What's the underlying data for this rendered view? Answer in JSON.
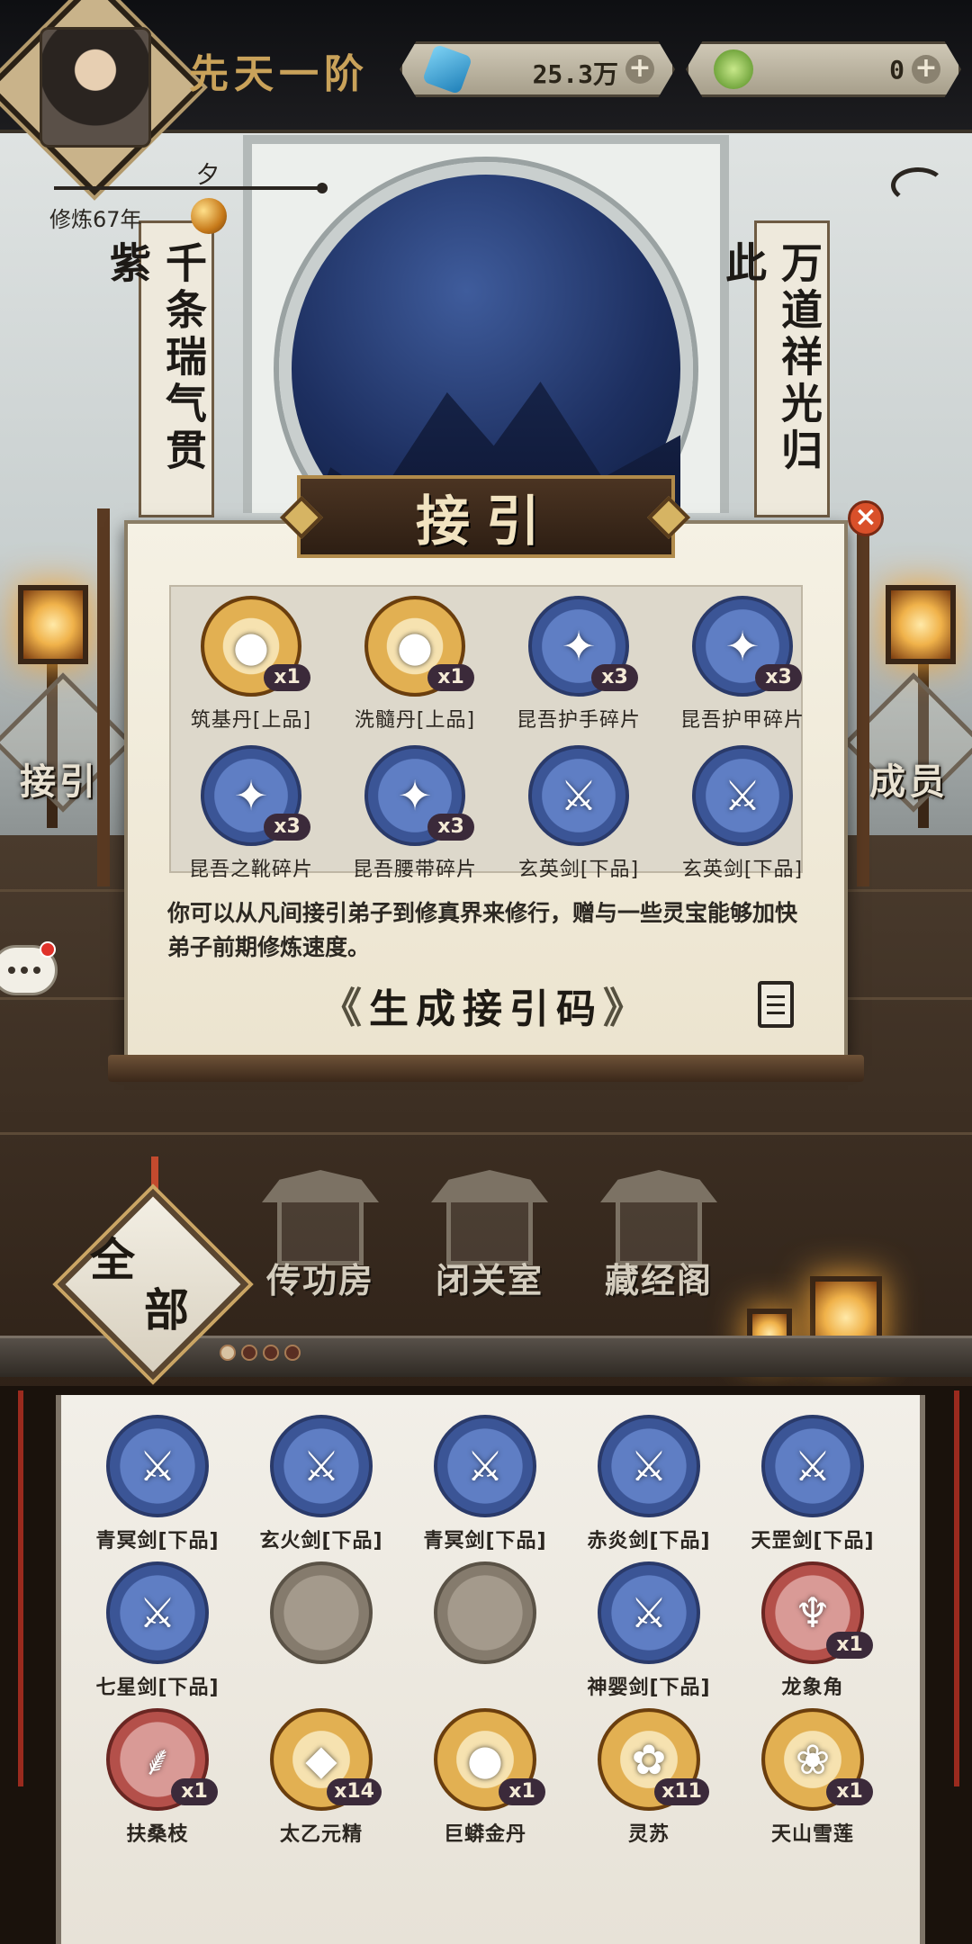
{
  "header": {
    "rank_title": "先天一阶",
    "player_name": "夕",
    "cultivation_text": "修炼67年",
    "currencies": [
      {
        "name": "spirit-stone",
        "value": "25.3万",
        "plus": "+",
        "color": "#3aa7d8"
      },
      {
        "name": "jade-coin",
        "value": "0",
        "plus": "+",
        "color": "#6fa83a"
      }
    ]
  },
  "scene": {
    "left_couplet": "千条瑞气贯紫",
    "right_couplet": "万道祥光归此",
    "side_left_label": "接引",
    "side_right_label": "成员"
  },
  "modal": {
    "title": "接引",
    "close": "×",
    "rewards": [
      {
        "label": "筑基丹[上品]",
        "qty": "x1",
        "style": "gold",
        "icon": "pill-bowl-icon",
        "glyph": "●"
      },
      {
        "label": "洗髓丹[上品]",
        "qty": "x1",
        "style": "gold",
        "icon": "purple-pill-icon",
        "glyph": "●"
      },
      {
        "label": "昆吾护手碎片",
        "qty": "x3",
        "style": "blue",
        "icon": "gauntlet-fragment-icon",
        "glyph": "✦"
      },
      {
        "label": "昆吾护甲碎片",
        "qty": "x3",
        "style": "blue",
        "icon": "armor-fragment-icon",
        "glyph": "✦"
      },
      {
        "label": "昆吾之靴碎片",
        "qty": "x3",
        "style": "blue",
        "icon": "boots-fragment-icon",
        "glyph": "✦"
      },
      {
        "label": "昆吾腰带碎片",
        "qty": "x3",
        "style": "blue",
        "icon": "belt-fragment-icon",
        "glyph": "✦"
      },
      {
        "label": "玄英剑[下品]",
        "qty": "",
        "style": "blue",
        "icon": "sword-icon",
        "glyph": "⚔"
      },
      {
        "label": "玄英剑[下品]",
        "qty": "",
        "style": "blue",
        "icon": "sword-icon",
        "glyph": "⚔"
      }
    ],
    "description": "你可以从凡间接引弟子到修真界来修行，赠与一些灵宝能够加快弟子前期修炼速度。",
    "generate_button": "生成接引码",
    "chev_left": "《",
    "chev_right": "》"
  },
  "buildings": [
    {
      "label": "传功房"
    },
    {
      "label": "闭关室"
    },
    {
      "label": "藏经阁"
    }
  ],
  "filter_tab": {
    "label_top": "全",
    "label_bottom": "部"
  },
  "inventory": [
    {
      "label": "青冥剑[下品]",
      "qty": "",
      "style": "blue",
      "icon": "purple-sword-icon",
      "glyph": "⚔"
    },
    {
      "label": "玄火剑[下品]",
      "qty": "",
      "style": "blue",
      "icon": "fire-sword-icon",
      "glyph": "⚔"
    },
    {
      "label": "青冥剑[下品]",
      "qty": "",
      "style": "blue",
      "icon": "purple-sword-icon",
      "glyph": "⚔"
    },
    {
      "label": "赤炎剑[下品]",
      "qty": "",
      "style": "blue",
      "icon": "flame-sword-icon",
      "glyph": "⚔"
    },
    {
      "label": "天罡剑[下品]",
      "qty": "",
      "style": "blue",
      "icon": "gold-sword-icon",
      "glyph": "⚔"
    },
    {
      "label": "七星剑[下品]",
      "qty": "",
      "style": "blue",
      "icon": "star-sword-icon",
      "glyph": "⚔"
    },
    {
      "label": "",
      "qty": "",
      "style": "gray",
      "icon": "empty-slot-icon",
      "glyph": ""
    },
    {
      "label": "",
      "qty": "",
      "style": "gray",
      "icon": "empty-slot-icon",
      "glyph": ""
    },
    {
      "label": "神婴剑[下品]",
      "qty": "",
      "style": "blue",
      "icon": "dark-sword-icon",
      "glyph": "⚔"
    },
    {
      "label": "龙象角",
      "qty": "x1",
      "style": "red",
      "icon": "horn-icon",
      "glyph": "♆"
    },
    {
      "label": "扶桑枝",
      "qty": "x1",
      "style": "red",
      "icon": "branch-icon",
      "glyph": "⸙"
    },
    {
      "label": "太乙元精",
      "qty": "x14",
      "style": "gold",
      "icon": "crystal-icon",
      "glyph": "◆"
    },
    {
      "label": "巨蟒金丹",
      "qty": "x1",
      "style": "gold",
      "icon": "pearl-icon",
      "glyph": "●"
    },
    {
      "label": "灵苏",
      "qty": "x11",
      "style": "gold",
      "icon": "herb-icon",
      "glyph": "✿"
    },
    {
      "label": "天山雪莲",
      "qty": "x1",
      "style": "gold",
      "icon": "lotus-icon",
      "glyph": "❀"
    }
  ]
}
